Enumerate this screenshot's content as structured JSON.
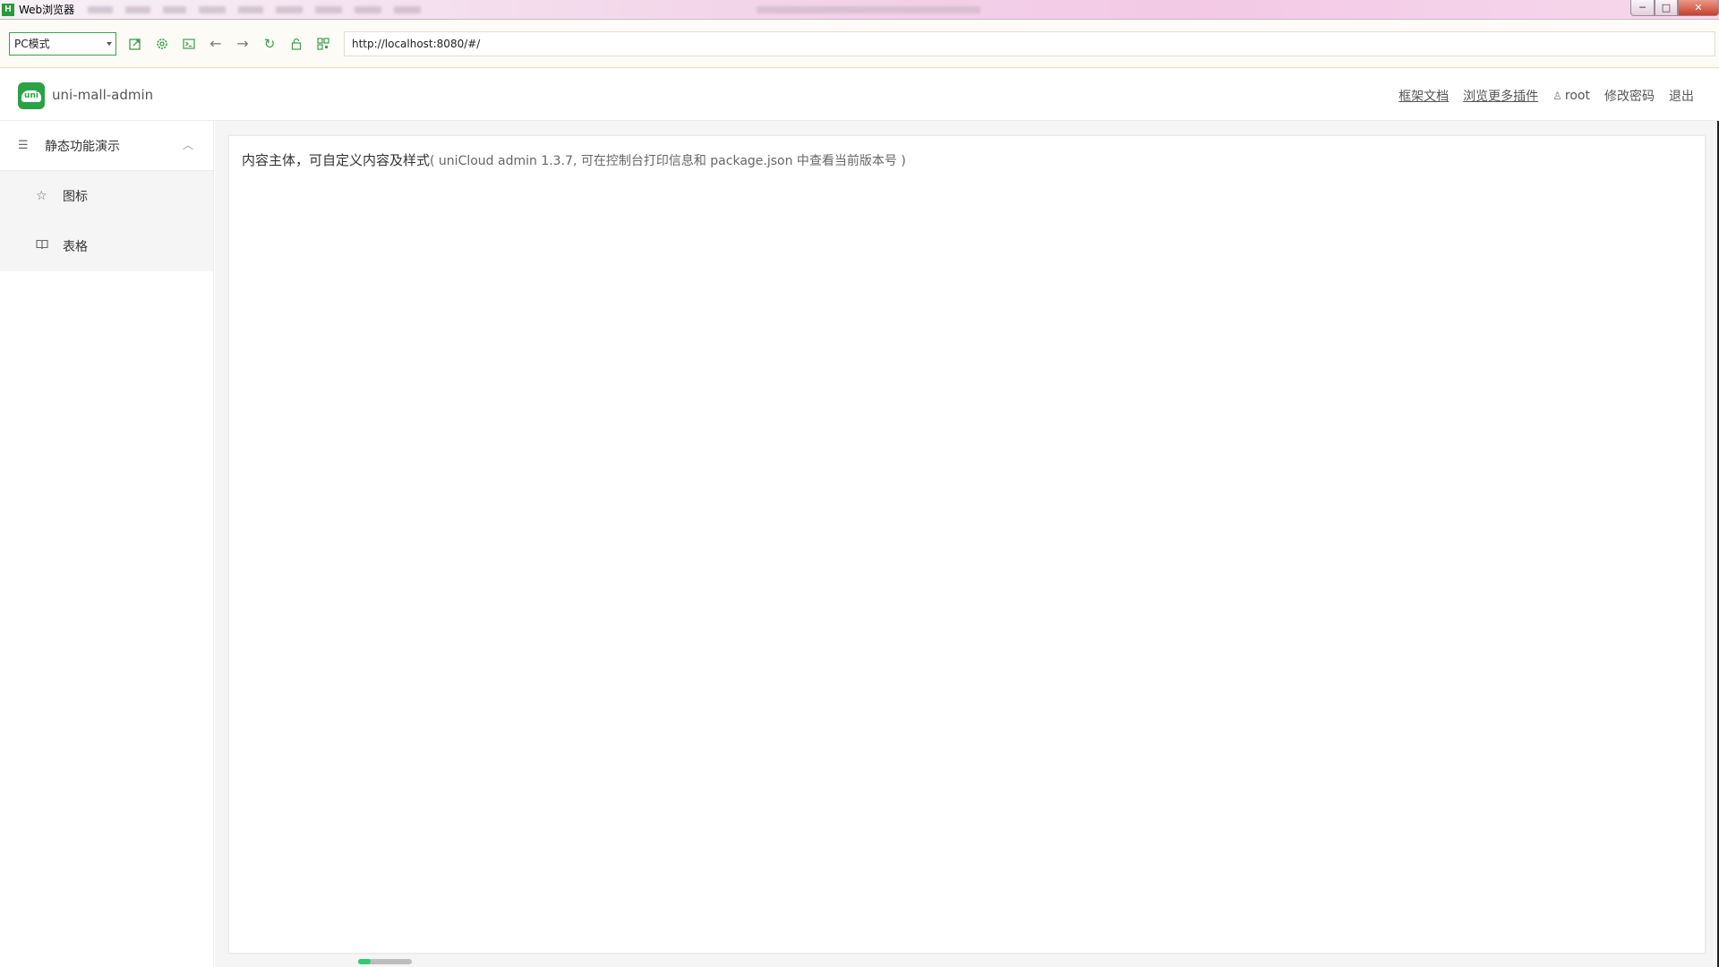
{
  "window": {
    "app_title": "Web浏览器",
    "app_icon_letter": "H",
    "controls": {
      "minimize": "─",
      "maximize": "□",
      "close": "✕"
    }
  },
  "toolbar": {
    "mode_select_value": "PC模式",
    "url": "http://localhost:8080/#/",
    "icons": [
      "open-external-icon",
      "settings-icon",
      "console-icon",
      "back-arrow-icon",
      "forward-arrow-icon",
      "refresh-icon",
      "lock-icon",
      "qrcode-icon"
    ]
  },
  "header": {
    "app_name": "uni-mall-admin",
    "logo_text": "uni",
    "links": {
      "docs": "框架文档",
      "plugins": "浏览更多插件",
      "user": "root",
      "change_password": "修改密码",
      "logout": "退出"
    }
  },
  "sidebar": {
    "group": {
      "label": "静态功能演示",
      "icon": "list-icon",
      "expanded": true
    },
    "items": [
      {
        "label": "图标",
        "icon": "star-icon"
      },
      {
        "label": "表格",
        "icon": "book-icon"
      }
    ]
  },
  "main": {
    "heading": "内容主体，可自定义内容及样式",
    "description": "( uniCloud admin 1.3.7, 可在控制台打印信息和 package.json 中查看当前版本号 )"
  },
  "colors": {
    "accent": "#2ba245",
    "sidebar_sub_bg": "#f5f5f5",
    "content_bg": "#f5f5f5"
  }
}
